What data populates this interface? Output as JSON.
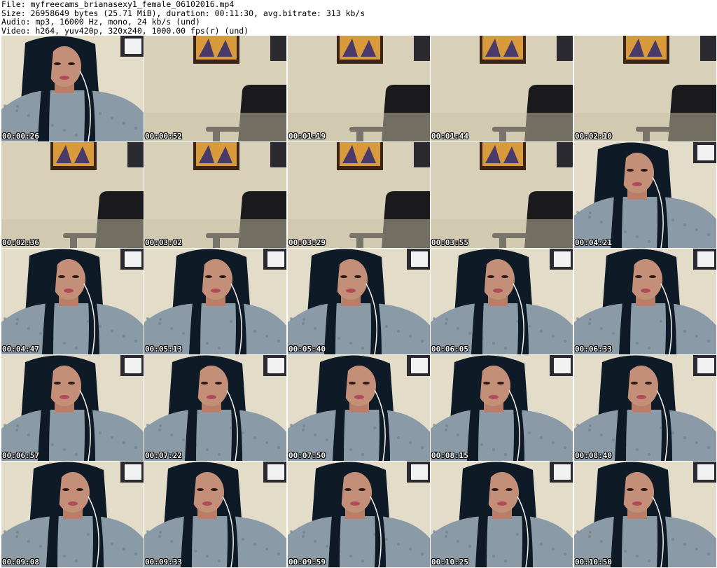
{
  "header": {
    "lines": [
      "File: myfreecams_brianasexy1_female_06102016.mp4",
      "Size: 26958649 bytes (25.71 MiB), duration: 00:11:30, avg.bitrate: 313 kb/s",
      "Audio: mp3, 16000 Hz, mono, 24 kb/s (und)",
      "Video: h264, yuv420p, 320x240, 1000.00 fps(r) (und)"
    ]
  },
  "thumbnails": [
    {
      "timestamp": "00:00:26",
      "scene": "person"
    },
    {
      "timestamp": "00:00:52",
      "scene": "empty"
    },
    {
      "timestamp": "00:01:19",
      "scene": "empty"
    },
    {
      "timestamp": "00:01:44",
      "scene": "empty"
    },
    {
      "timestamp": "00:02:10",
      "scene": "empty"
    },
    {
      "timestamp": "00:02:36",
      "scene": "empty"
    },
    {
      "timestamp": "00:03:02",
      "scene": "empty"
    },
    {
      "timestamp": "00:03:29",
      "scene": "empty"
    },
    {
      "timestamp": "00:03:55",
      "scene": "empty"
    },
    {
      "timestamp": "00:04:21",
      "scene": "person"
    },
    {
      "timestamp": "00:04:47",
      "scene": "person"
    },
    {
      "timestamp": "00:05:13",
      "scene": "person"
    },
    {
      "timestamp": "00:05:40",
      "scene": "person"
    },
    {
      "timestamp": "00:06:05",
      "scene": "person"
    },
    {
      "timestamp": "00:06:33",
      "scene": "person"
    },
    {
      "timestamp": "00:06:57",
      "scene": "person"
    },
    {
      "timestamp": "00:07:22",
      "scene": "person"
    },
    {
      "timestamp": "00:07:50",
      "scene": "person"
    },
    {
      "timestamp": "00:08:15",
      "scene": "person"
    },
    {
      "timestamp": "00:08:40",
      "scene": "person"
    },
    {
      "timestamp": "00:09:08",
      "scene": "person"
    },
    {
      "timestamp": "00:09:33",
      "scene": "person"
    },
    {
      "timestamp": "00:09:59",
      "scene": "person"
    },
    {
      "timestamp": "00:10:25",
      "scene": "person"
    },
    {
      "timestamp": "00:10:50",
      "scene": "person"
    }
  ],
  "colors": {
    "wall": "#d8d0b8",
    "chair": "#1a1a1c",
    "hair": "#0e1a26",
    "sweater": "#8a9aa6",
    "skin": "#c48f78",
    "frame": "#3a2418",
    "poster": "#d89a3a",
    "timestamp_text": "#ffffff"
  }
}
